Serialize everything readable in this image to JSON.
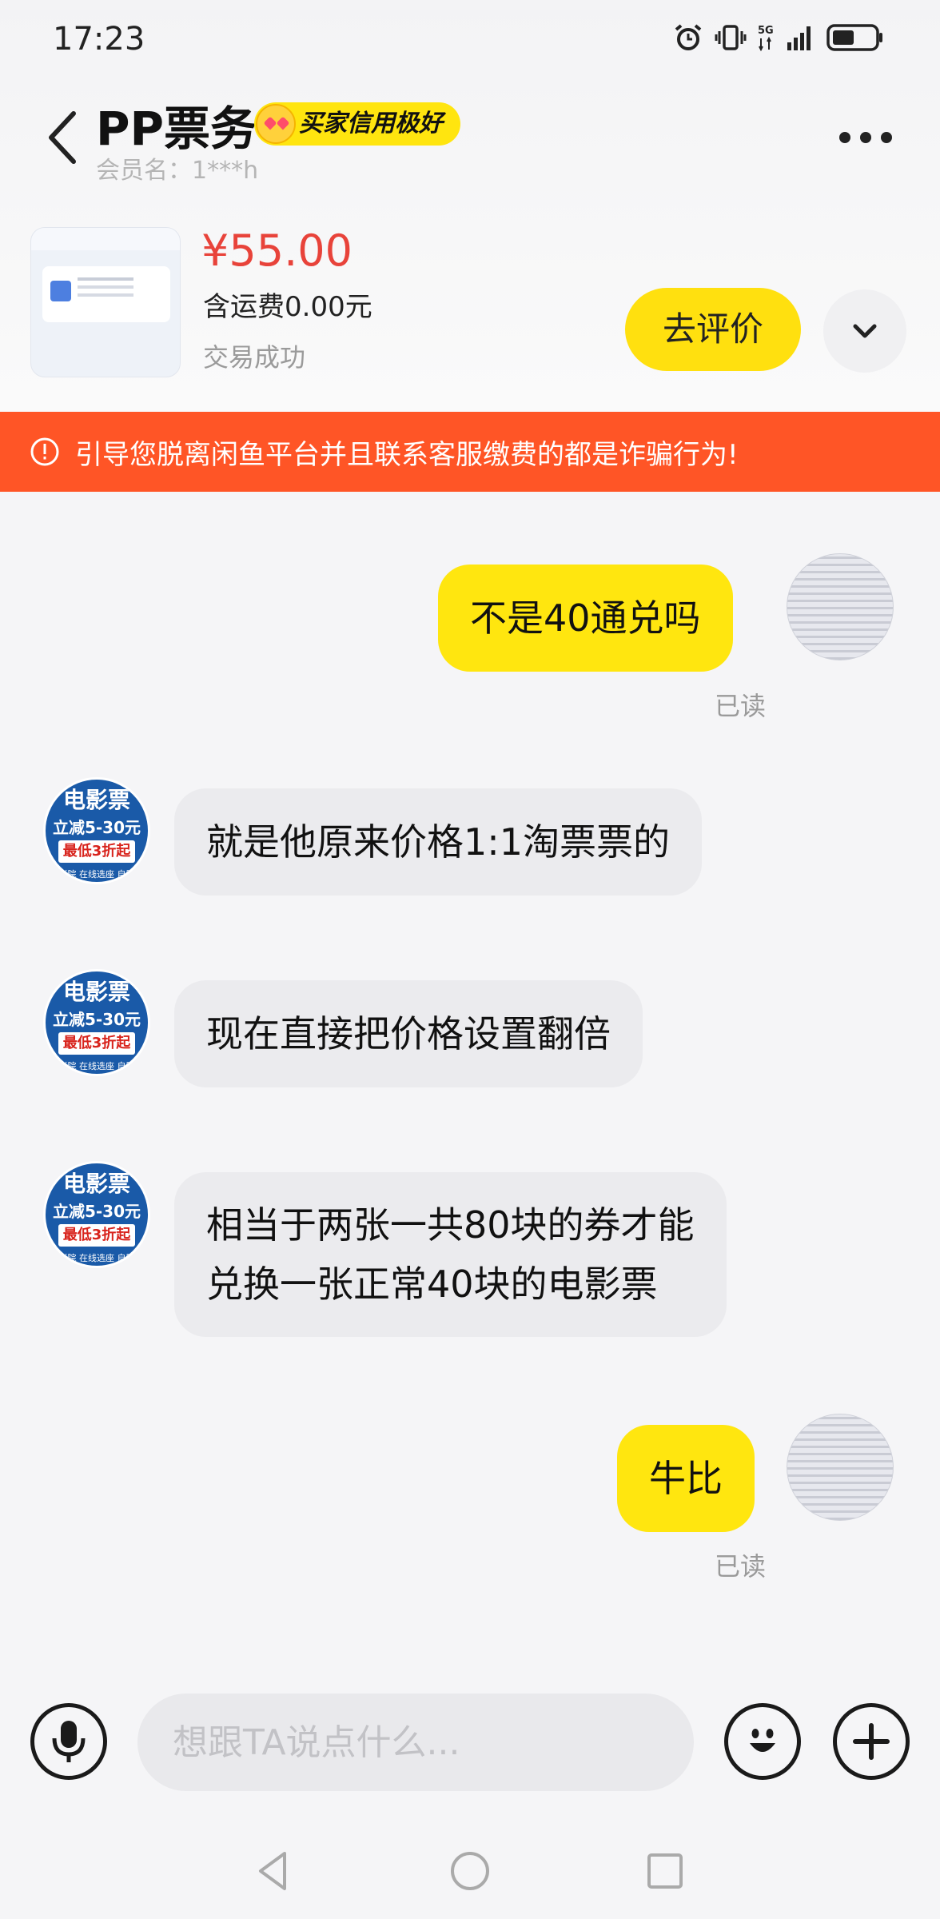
{
  "status_bar": {
    "time": "17:23",
    "network": "5G",
    "icons": [
      "alarm-icon",
      "vibrate-icon",
      "5g-icon",
      "signal-icon",
      "battery-icon"
    ]
  },
  "header": {
    "shop_name": "PP票务",
    "credit_badge": "买家信用极好",
    "member_name": "会员名：1***h",
    "back_icon": "chevron-left-icon",
    "more_icon": "more-dots-icon"
  },
  "product": {
    "price": "¥55.00",
    "shipping": "含运费0.00元",
    "status": "交易成功",
    "review_button": "去评价",
    "expand_icon": "chevron-down-icon"
  },
  "warning": {
    "text": "引导您脱离闲鱼平台并且联系客服缴费的都是诈骗行为!",
    "icon": "alert-circle-icon"
  },
  "messages": [
    {
      "sender": "me",
      "text": "不是40通兑吗",
      "status": "已读"
    },
    {
      "sender": "them",
      "text": "就是他原来价格1:1淘票票的"
    },
    {
      "sender": "them",
      "text": "现在直接把价格设置翻倍"
    },
    {
      "sender": "them",
      "text_line1": "相当于两张一共80块的券才能",
      "text_line2": "兑换一张正常40块的电影票"
    },
    {
      "sender": "me",
      "text": "牛比",
      "status": "已读"
    }
  ],
  "shop_avatar": {
    "line1": "电影票",
    "line2": "立减5-30元",
    "line3": "最低3折起",
    "line4": "影院 在线选座 自助"
  },
  "input_bar": {
    "placeholder": "想跟TA说点什么...",
    "voice_icon": "microphone-icon",
    "emoji_icon": "emoji-icon",
    "plus_icon": "plus-icon"
  },
  "nav_bar": {
    "icons": [
      "back-triangle-icon",
      "home-circle-icon",
      "recents-square-icon"
    ]
  },
  "colors": {
    "accent_yellow": "#ffe60f",
    "price_red": "#e8433a",
    "warning_orange": "#ff5526",
    "shop_avatar_blue": "#1a5aa8"
  }
}
